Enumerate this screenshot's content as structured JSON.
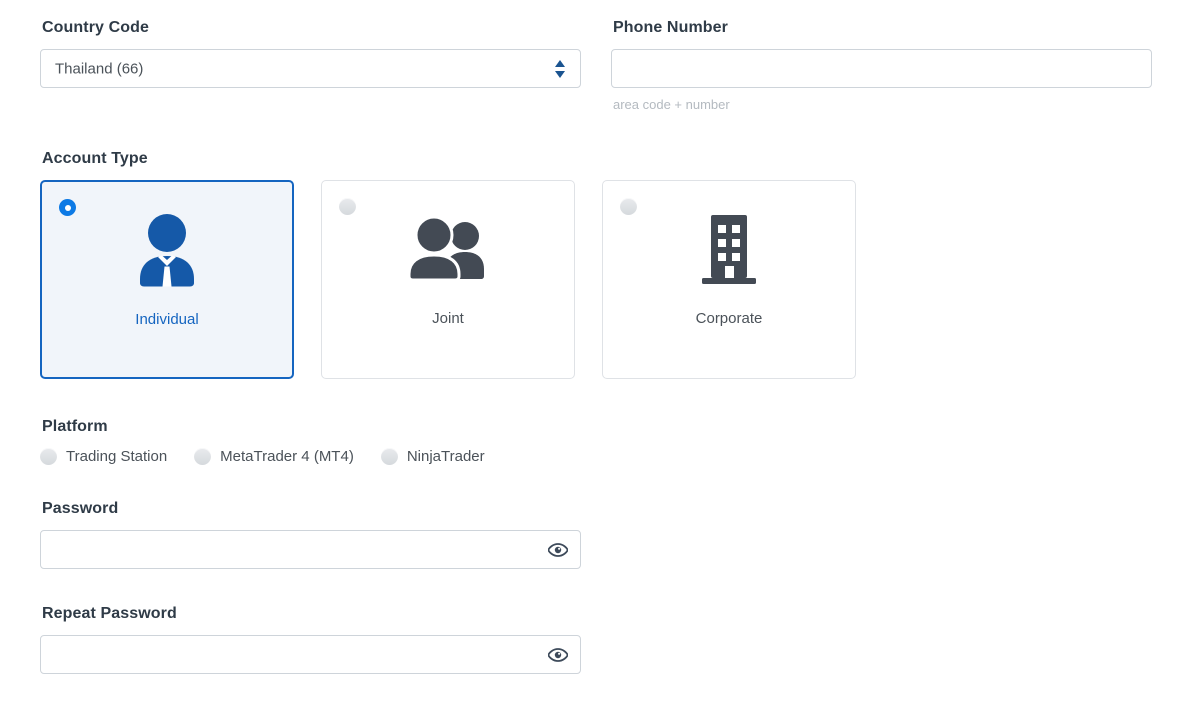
{
  "form": {
    "country": {
      "label": "Country Code",
      "value": "Thailand (66)",
      "options": [
        "Thailand (66)"
      ]
    },
    "phone": {
      "label": "Phone Number",
      "value": "",
      "placeholder": "",
      "helper": "area code + number"
    },
    "account_type": {
      "label": "Account Type",
      "selected": "Individual",
      "options": [
        {
          "label": "Individual",
          "icon": "business-person-icon",
          "selected": true
        },
        {
          "label": "Joint",
          "icon": "two-people-icon",
          "selected": false
        },
        {
          "label": "Corporate",
          "icon": "office-building-icon",
          "selected": false
        }
      ]
    },
    "platform": {
      "label": "Platform",
      "selected": "",
      "options": [
        {
          "label": "Trading Station",
          "selected": false
        },
        {
          "label": "MetaTrader 4 (MT4)",
          "selected": false
        },
        {
          "label": "NinjaTrader",
          "selected": false
        }
      ]
    },
    "password": {
      "label": "Password",
      "value": "",
      "placeholder": "",
      "reveal_icon": "eye-icon"
    },
    "repeat_password": {
      "label": "Repeat Password",
      "value": "",
      "placeholder": "",
      "reveal_icon": "eye-icon"
    }
  },
  "colors": {
    "accent_blue": "#1565c0",
    "radio_blue": "#0d7ae5",
    "icon_blue": "#1559a8",
    "icon_gray": "#434a54",
    "border_gray": "#ced4da",
    "card_selected_bg": "#f1f5fa",
    "helper_gray": "#b4bac0",
    "text_dark": "#2f3b47"
  }
}
